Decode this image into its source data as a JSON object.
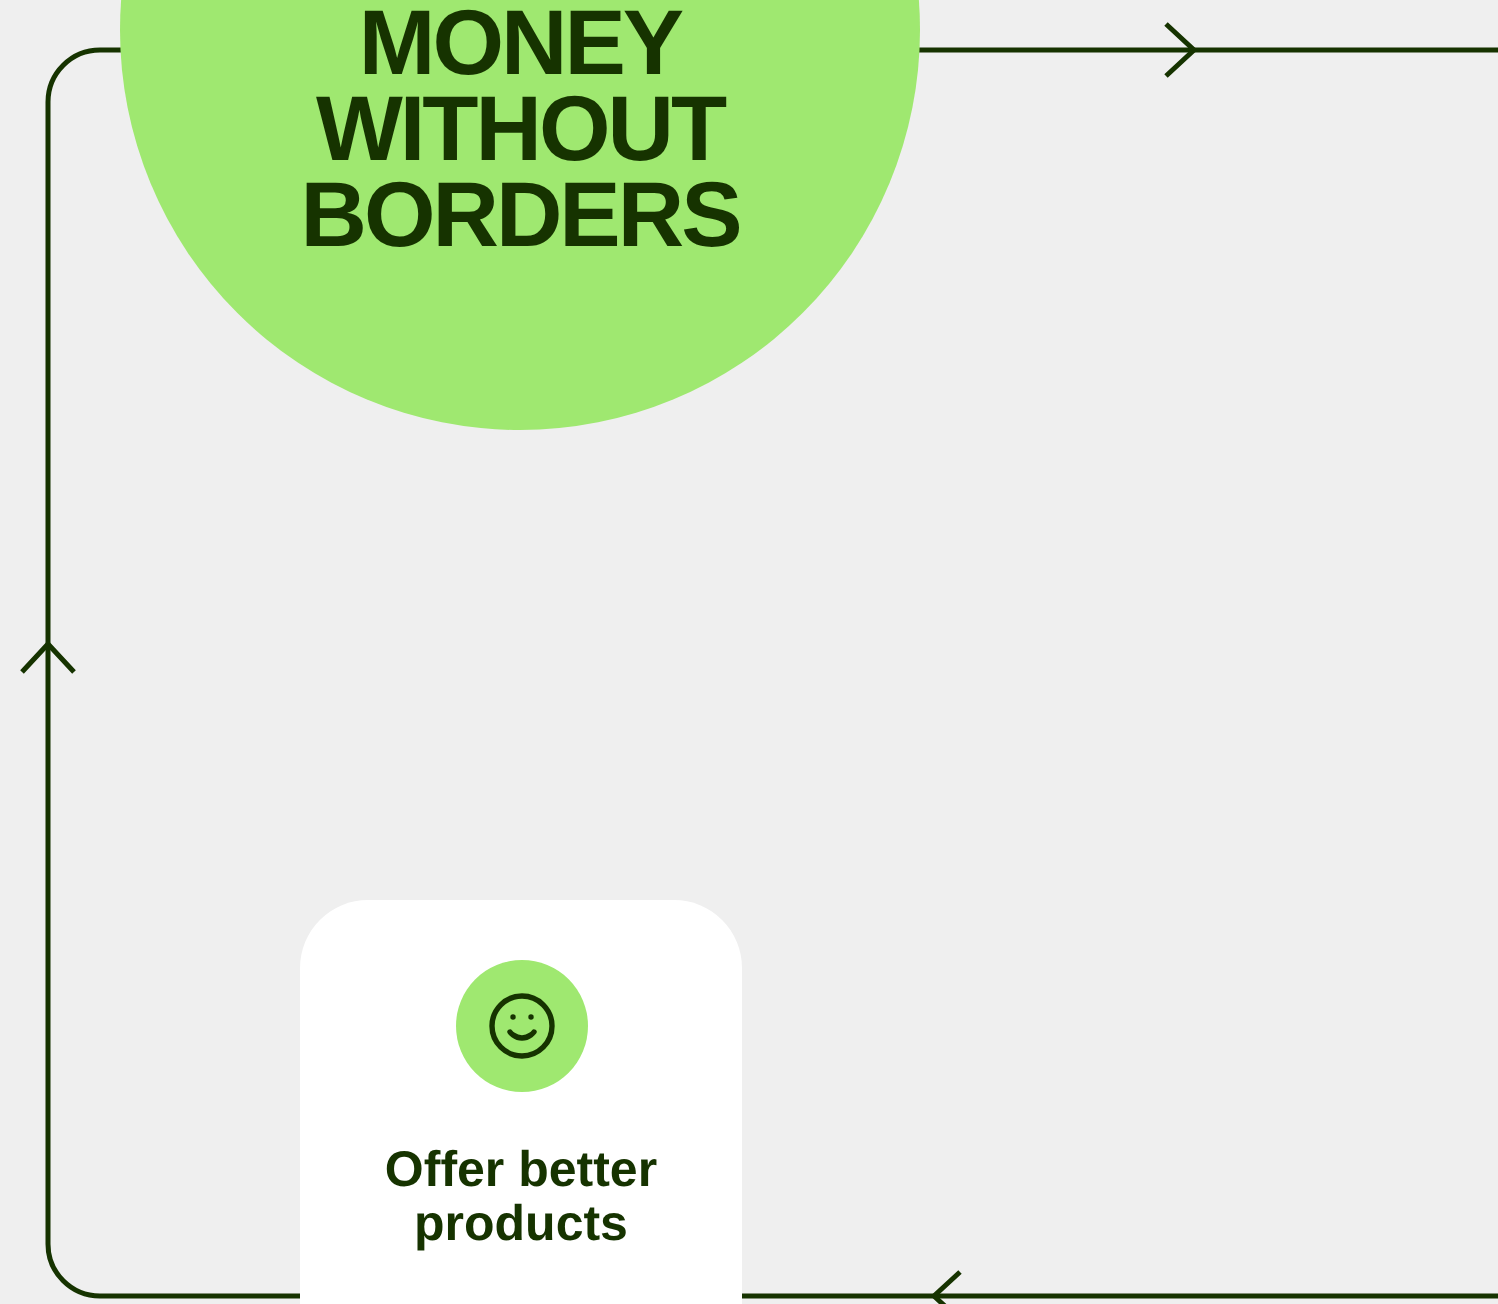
{
  "headline": {
    "lines": [
      "MONEY",
      "WITHOUT",
      "BORDERS"
    ]
  },
  "card": {
    "title": "Offer better products"
  }
}
